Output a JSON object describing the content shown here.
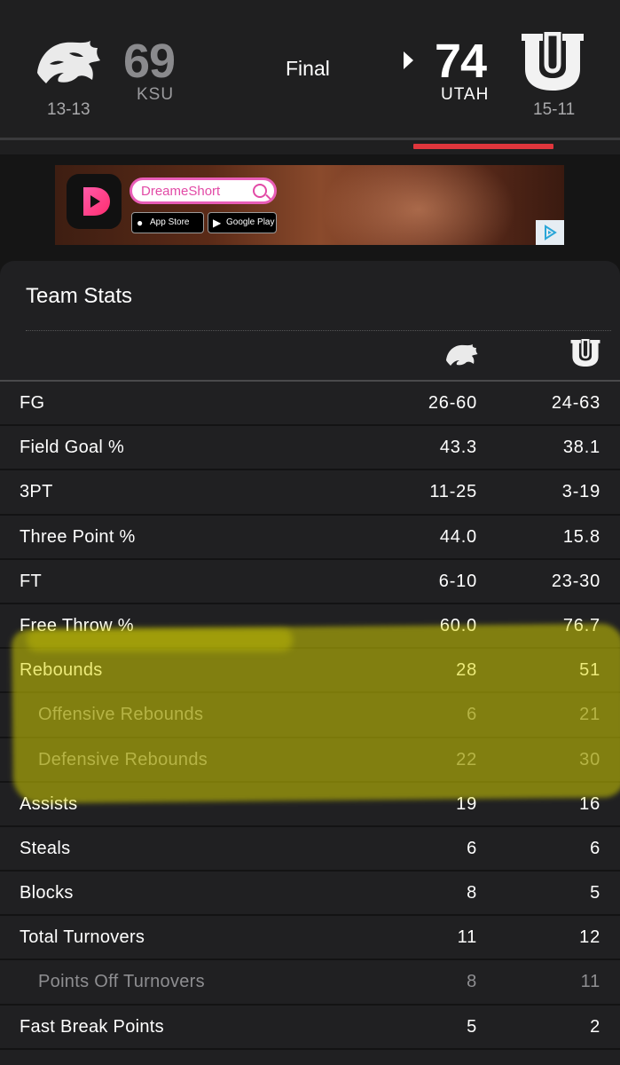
{
  "game": {
    "status": "Final",
    "away": {
      "abbr": "KSU",
      "score": "69",
      "record": "13-13",
      "logo_icon": "wildcat-logo-icon"
    },
    "home": {
      "abbr": "UTAH",
      "score": "74",
      "record": "15-11",
      "logo_icon": "utah-u-logo-icon",
      "winner": true
    }
  },
  "ad": {
    "search_text": "DreameShort",
    "app_store_label": "App Store",
    "google_play_label": "Google Play"
  },
  "team_stats": {
    "title": "Team Stats",
    "rows": [
      {
        "label": "FG",
        "ksu": "26-60",
        "utah": "24-63",
        "sub": false
      },
      {
        "label": "Field Goal %",
        "ksu": "43.3",
        "utah": "38.1",
        "sub": false
      },
      {
        "label": "3PT",
        "ksu": "11-25",
        "utah": "3-19",
        "sub": false
      },
      {
        "label": "Three Point %",
        "ksu": "44.0",
        "utah": "15.8",
        "sub": false
      },
      {
        "label": "FT",
        "ksu": "6-10",
        "utah": "23-30",
        "sub": false
      },
      {
        "label": "Free Throw %",
        "ksu": "60.0",
        "utah": "76.7",
        "sub": false
      },
      {
        "label": "Rebounds",
        "ksu": "28",
        "utah": "51",
        "sub": false
      },
      {
        "label": "Offensive Rebounds",
        "ksu": "6",
        "utah": "21",
        "sub": true
      },
      {
        "label": "Defensive Rebounds",
        "ksu": "22",
        "utah": "30",
        "sub": true
      },
      {
        "label": "Assists",
        "ksu": "19",
        "utah": "16",
        "sub": false
      },
      {
        "label": "Steals",
        "ksu": "6",
        "utah": "6",
        "sub": false
      },
      {
        "label": "Blocks",
        "ksu": "8",
        "utah": "5",
        "sub": false
      },
      {
        "label": "Total Turnovers",
        "ksu": "11",
        "utah": "12",
        "sub": false
      },
      {
        "label": "Points Off Turnovers",
        "ksu": "8",
        "utah": "11",
        "sub": true
      },
      {
        "label": "Fast Break Points",
        "ksu": "5",
        "utah": "2",
        "sub": false
      }
    ]
  },
  "colors": {
    "accent": "#e0363c",
    "highlight": "#dad600",
    "background": "#202022"
  }
}
